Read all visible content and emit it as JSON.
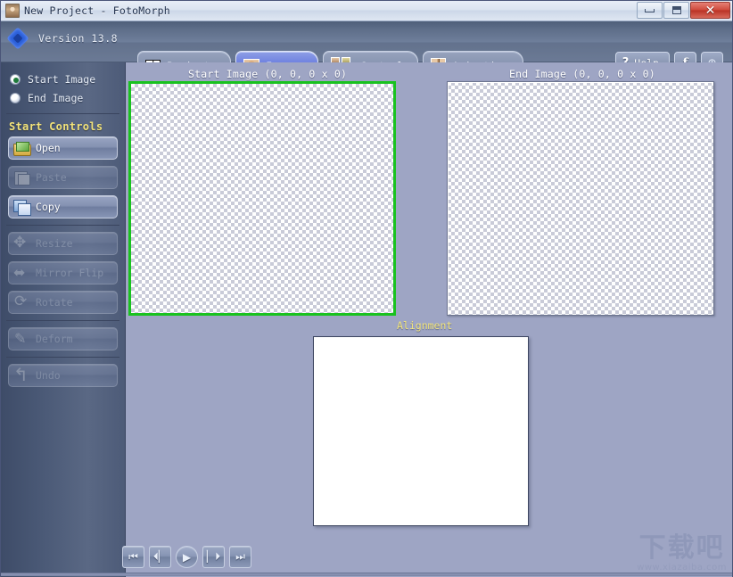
{
  "window": {
    "title": "New Project - FotoMorph",
    "icon": "app-photo-icon",
    "buttons": {
      "minimize": "–",
      "maximize": "□",
      "close": "✕"
    }
  },
  "header": {
    "version": "Version 13.8",
    "logo_icon": "fotomorph-diamond-logo",
    "tabs": [
      {
        "label": "Projects",
        "icon": "grid-icon",
        "active": false
      },
      {
        "label": "Images",
        "icon": "portrait-icon",
        "active": true
      },
      {
        "label": "Control",
        "icon": "three-frames-icon",
        "active": false
      },
      {
        "label": "Animation",
        "icon": "film-frame-icon",
        "active": false
      }
    ],
    "help_label": "Help",
    "help_icon": "question-mark-icon",
    "facebook_icon": "facebook-icon",
    "facebook_glyph": "f",
    "web_icon": "globe-icon",
    "web_glyph": "⊕"
  },
  "sidebar": {
    "radios": [
      {
        "label": "Start Image",
        "selected": true
      },
      {
        "label": "End Image",
        "selected": false
      }
    ],
    "section_title": "Start Controls",
    "groups": [
      {
        "buttons": [
          {
            "label": "Open",
            "icon": "open-folder-icon",
            "enabled": true
          },
          {
            "label": "Paste",
            "icon": "paste-icon",
            "enabled": false
          },
          {
            "label": "Copy",
            "icon": "copy-icon",
            "enabled": true
          }
        ]
      },
      {
        "buttons": [
          {
            "label": "Resize",
            "icon": "resize-arrows-icon",
            "enabled": false
          },
          {
            "label": "Mirror Flip",
            "icon": "mirror-flip-icon",
            "enabled": false
          },
          {
            "label": "Rotate",
            "icon": "rotate-icon",
            "enabled": false
          }
        ]
      },
      {
        "buttons": [
          {
            "label": "Deform",
            "icon": "deform-pen-icon",
            "enabled": false
          }
        ]
      },
      {
        "buttons": [
          {
            "label": "Undo",
            "icon": "undo-arrow-icon",
            "enabled": false
          }
        ]
      }
    ]
  },
  "main": {
    "start_panel": {
      "caption": "Start Image (0, 0, 0 x 0)",
      "selected_border_color": "#19c21f",
      "content": "empty-transparent-checkerboard"
    },
    "end_panel": {
      "caption": "End Image (0, 0, 0 x 0)",
      "content": "empty-transparent-checkerboard"
    },
    "alignment": {
      "label": "Alignment",
      "label_color": "#f4e77e",
      "preview": "blank-white-preview"
    }
  },
  "transport": {
    "buttons": [
      {
        "name": "first-frame",
        "glyph": "⏮"
      },
      {
        "name": "previous-frame",
        "glyph": "⏴▏"
      },
      {
        "name": "play",
        "glyph": "▶"
      },
      {
        "name": "next-frame",
        "glyph": "▏⏵"
      },
      {
        "name": "last-frame",
        "glyph": "⏭"
      }
    ]
  },
  "watermark": {
    "text": "下载吧",
    "url": "www.xiazaiba.com"
  },
  "theme": {
    "accent": "#5468d6",
    "workspace_bg": "#9ea5c4",
    "sidebar_bg": "#4b5a77",
    "selection_green": "#19c21f",
    "section_yellow": "#f2e37a"
  }
}
